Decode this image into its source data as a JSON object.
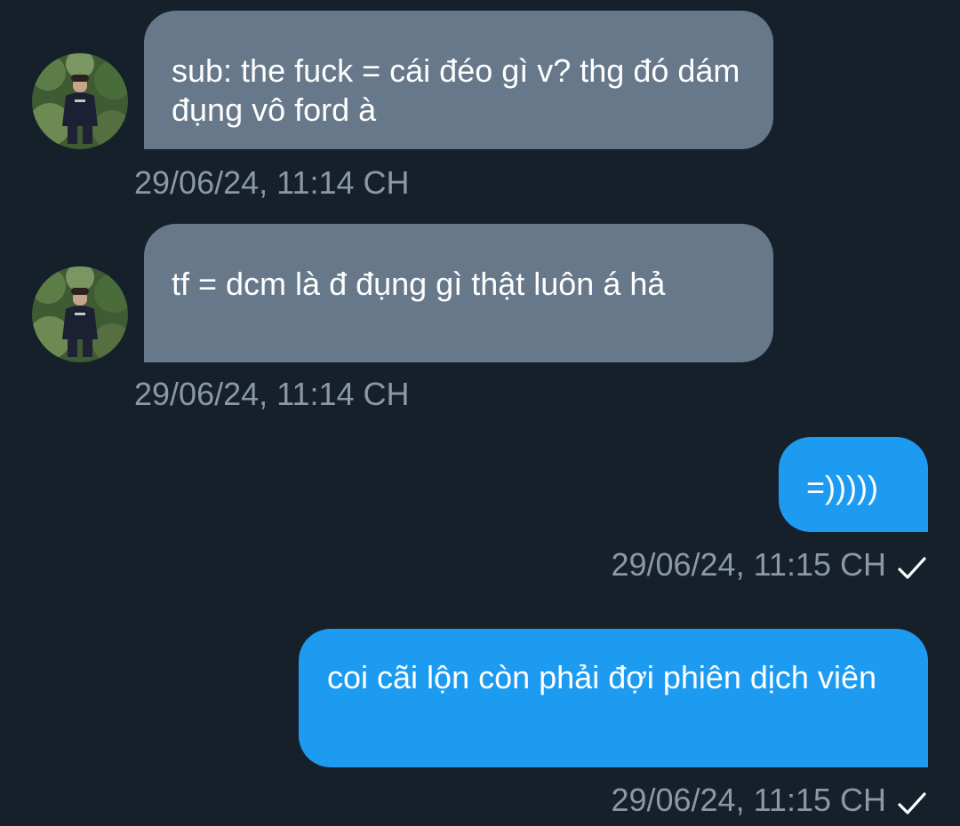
{
  "messages": [
    {
      "direction": "incoming",
      "text": "sub: the fuck = cái đéo gì v? thg đó dám đụng vô ford à",
      "timestamp": "29/06/24, 11:14 CH",
      "avatar": "user-avatar"
    },
    {
      "direction": "incoming",
      "text": "tf = dcm là đ đụng gì thật luôn á hả",
      "timestamp": "29/06/24, 11:14 CH",
      "avatar": "user-avatar"
    },
    {
      "direction": "outgoing",
      "text": "=)))))",
      "timestamp": "29/06/24, 11:15 CH",
      "status_icon": "check-icon"
    },
    {
      "direction": "outgoing",
      "text": "coi cãi lộn còn phải đợi phiên dịch viên",
      "timestamp": "29/06/24, 11:15 CH",
      "status_icon": "check-icon"
    }
  ],
  "colors": {
    "background": "#16202b",
    "incoming_bubble": "#66788a",
    "outgoing_bubble": "#1d9bf0",
    "timestamp_text": "#8b98a5",
    "message_text": "#ffffff"
  }
}
